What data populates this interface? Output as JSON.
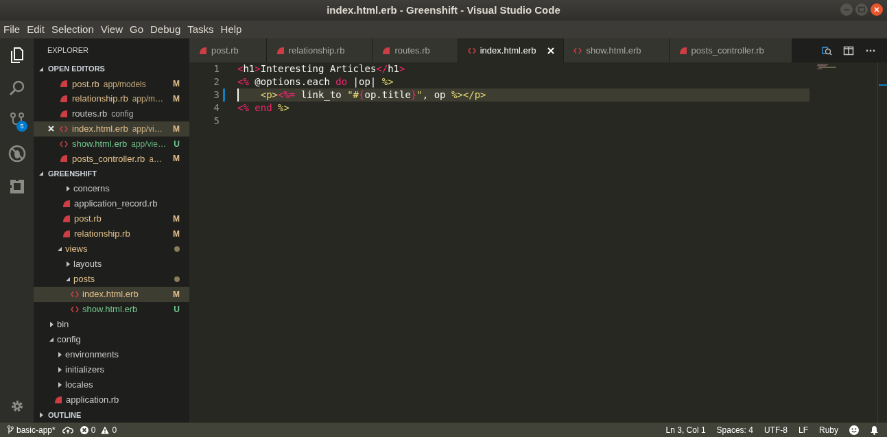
{
  "window": {
    "title": "index.html.erb - Greenshift - Visual Studio Code"
  },
  "menu": [
    "File",
    "Edit",
    "Selection",
    "View",
    "Go",
    "Debug",
    "Tasks",
    "Help"
  ],
  "activity_bar": [
    {
      "kind": "explorer",
      "selected": true
    },
    {
      "kind": "search",
      "selected": false
    },
    {
      "kind": "source_control",
      "selected": false,
      "badge": "5"
    },
    {
      "kind": "debug",
      "selected": false
    },
    {
      "kind": "extensions",
      "selected": false
    }
  ],
  "sidebar": {
    "title": "EXPLORER",
    "open_editors": {
      "title": "OPEN EDITORS",
      "expanded": true,
      "items": [
        {
          "name": "post.rb",
          "description": "app/models",
          "kind": "ruby",
          "color": "#e2c08d",
          "badge": "M",
          "selected": false
        },
        {
          "name": "relationship.rb",
          "description": "app/m…",
          "kind": "ruby",
          "color": "#e2c08d",
          "badge": "M",
          "selected": false
        },
        {
          "name": "routes.rb",
          "description": "config",
          "kind": "ruby",
          "color": "#cccccc",
          "selected": false
        },
        {
          "name": "index.html.erb",
          "description": "app/vi…",
          "kind": "html",
          "color": "#e2c08d",
          "badge": "M",
          "selected": true
        },
        {
          "name": "show.html.erb",
          "description": "app/vie…",
          "kind": "html",
          "color": "#73c991",
          "badge": "U",
          "selected": false
        },
        {
          "name": "posts_controller.rb",
          "description": "a…",
          "kind": "ruby",
          "color": "#e2c08d",
          "badge": "M",
          "selected": false
        }
      ]
    },
    "folder": {
      "title": "GREENSHIFT",
      "expanded": true,
      "tree": [
        {
          "children": [
            {
              "children": [
                {
                  "label": "concerns",
                  "kind": "folder",
                  "expanded": false
                },
                {
                  "label": "application_record.rb",
                  "kind": "ruby"
                },
                {
                  "label": "post.rb",
                  "kind": "ruby",
                  "color": "#e2c08d",
                  "badge": "M"
                },
                {
                  "label": "relationship.rb",
                  "kind": "ruby",
                  "color": "#e2c08d",
                  "badge": "M"
                }
              ]
            },
            {
              "label": "views",
              "kind": "folder",
              "expanded": true,
              "color": "#e2c08d",
              "dot": true,
              "children": [
                {
                  "label": "layouts",
                  "kind": "folder",
                  "expanded": false
                },
                {
                  "label": "posts",
                  "kind": "folder",
                  "expanded": true,
                  "color": "#e2c08d",
                  "dot": true,
                  "children": [
                    {
                      "label": "index.html.erb",
                      "kind": "html",
                      "color": "#e2c08d",
                      "badge": "M",
                      "selected": true
                    },
                    {
                      "label": "show.html.erb",
                      "kind": "html",
                      "color": "#73c991",
                      "badge": "U",
                      "selected": false
                    }
                  ]
                }
              ]
            }
          ]
        },
        {
          "label": "bin",
          "kind": "folder",
          "expanded": false
        },
        {
          "label": "config",
          "kind": "folder",
          "expanded": true,
          "children": [
            {
              "label": "environments",
              "kind": "folder",
              "expanded": false
            },
            {
              "label": "initializers",
              "kind": "folder",
              "expanded": false
            },
            {
              "label": "locales",
              "kind": "folder",
              "expanded": false
            },
            {
              "label": "application.rb",
              "kind": "ruby"
            }
          ]
        }
      ]
    },
    "outline": {
      "title": "OUTLINE",
      "expanded": false
    }
  },
  "tabs": [
    {
      "label": "post.rb",
      "kind": "ruby",
      "selected": false
    },
    {
      "label": "relationship.rb",
      "kind": "ruby",
      "selected": false
    },
    {
      "label": "routes.rb",
      "kind": "ruby",
      "selected": false
    },
    {
      "label": "index.html.erb",
      "kind": "html",
      "selected": true
    },
    {
      "label": "show.html.erb",
      "kind": "html",
      "selected": false
    },
    {
      "label": "posts_controller.rb",
      "kind": "ruby",
      "selected": false
    }
  ],
  "editor": {
    "lines": [
      {
        "number": "1",
        "current": false,
        "changed": false,
        "tokens": [
          {
            "kind": "keyword",
            "text": "<"
          },
          {
            "kind": "text",
            "text": "h1"
          },
          {
            "kind": "keyword",
            "text": ">"
          },
          {
            "kind": "text",
            "text": "Interesting Articles"
          },
          {
            "kind": "keyword",
            "text": "</"
          },
          {
            "kind": "text",
            "text": "h1"
          },
          {
            "kind": "keyword",
            "text": ">"
          }
        ]
      },
      {
        "number": "2",
        "current": false,
        "changed": false,
        "tokens": [
          {
            "kind": "keyword",
            "text": "<%"
          },
          {
            "kind": "text",
            "text": " @options.each "
          },
          {
            "kind": "keyword",
            "text": "do"
          },
          {
            "kind": "text",
            "text": " |op| "
          },
          {
            "kind": "string",
            "text": "%>"
          }
        ]
      },
      {
        "number": "3",
        "current": true,
        "changed": true,
        "tokens": [
          {
            "kind": "string",
            "text": "    <p>"
          },
          {
            "kind": "keyword",
            "text": "<%="
          },
          {
            "kind": "text",
            "text": " link_to "
          },
          {
            "kind": "string",
            "text": "\"#"
          },
          {
            "kind": "keyword",
            "text": "{"
          },
          {
            "kind": "text",
            "text": "op.title"
          },
          {
            "kind": "keyword",
            "text": "}"
          },
          {
            "kind": "string",
            "text": "\""
          },
          {
            "kind": "text",
            "text": ", op "
          },
          {
            "kind": "string",
            "text": "%></p>"
          }
        ]
      },
      {
        "number": "4",
        "current": false,
        "changed": false,
        "tokens": [
          {
            "kind": "keyword",
            "text": "<% end"
          },
          {
            "kind": "string",
            "text": " %>"
          }
        ]
      },
      {
        "number": "5",
        "current": false,
        "changed": false
      }
    ]
  },
  "status_bar": {
    "branch": "basic-app*",
    "errors": "0",
    "warnings": "0",
    "position": "Ln 3, Col 1",
    "indentation": "Spaces: 4",
    "encoding": "UTF-8",
    "eol": "LF",
    "language": "Ruby"
  }
}
